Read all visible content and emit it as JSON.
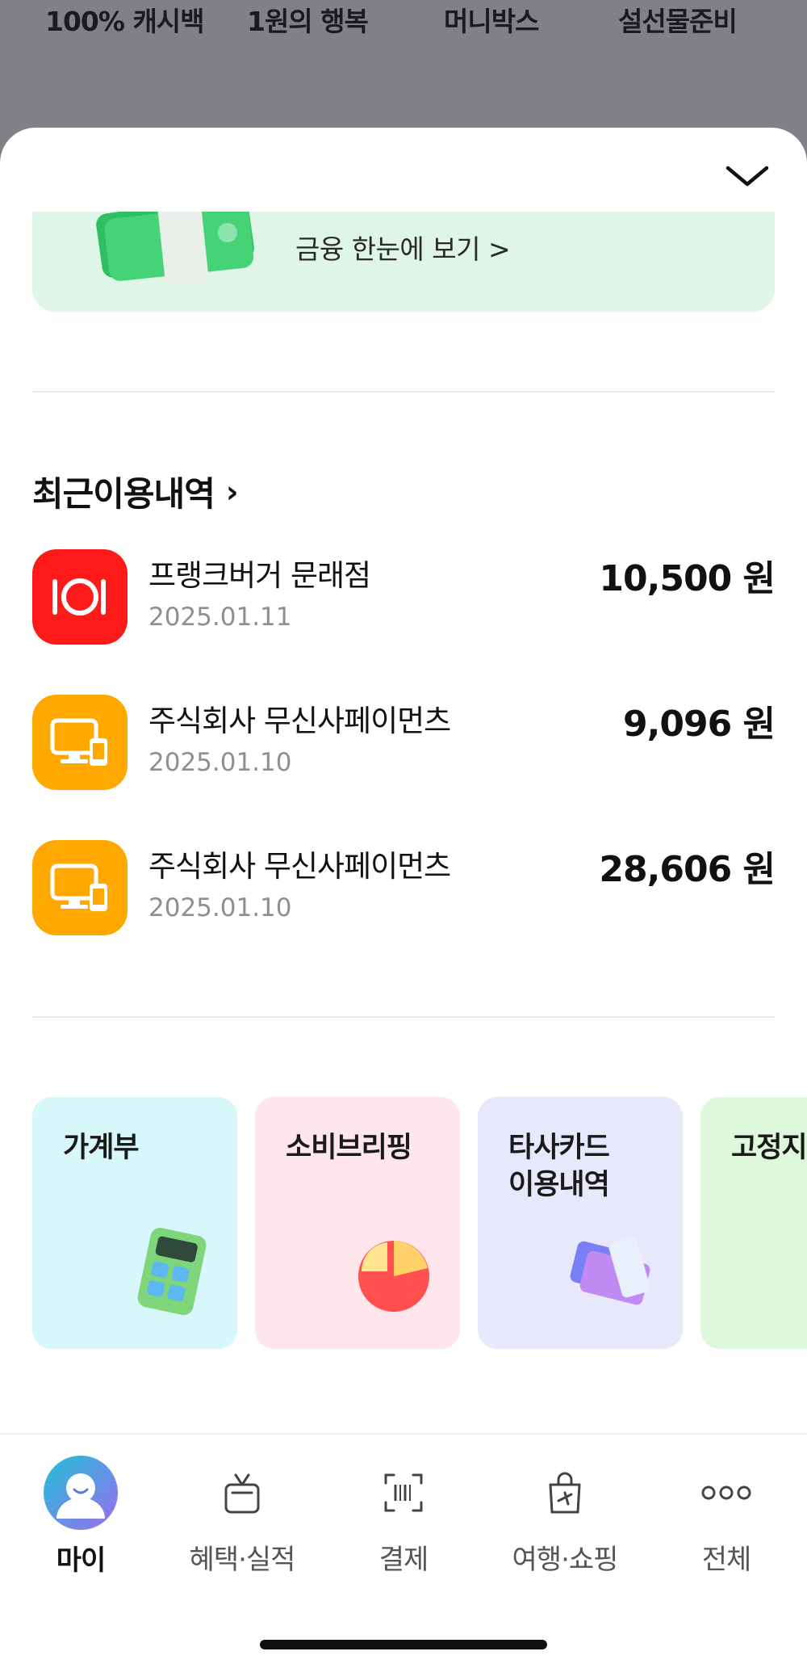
{
  "background_menu": [
    "100% 캐시백",
    "1원의 행복",
    "머니박스",
    "설선물준비"
  ],
  "promo": {
    "link_text": "금융 한눈에 보기 >"
  },
  "recent": {
    "title": "최근이용내역",
    "arrow": "›",
    "items": [
      {
        "name": "프랭크버거 문래점",
        "date": "2025.01.11",
        "amount": "10,500 원",
        "icon": "restaurant-icon",
        "color": "#ff1a1a"
      },
      {
        "name": "주식회사 무신사페이먼츠",
        "date": "2025.01.10",
        "amount": "9,096 원",
        "icon": "online-payment-icon",
        "color": "#ffa800"
      },
      {
        "name": "주식회사 무신사페이먼츠",
        "date": "2025.01.10",
        "amount": "28,606 원",
        "icon": "online-payment-icon",
        "color": "#ffa800"
      }
    ]
  },
  "cards": [
    {
      "label": "가계부",
      "bg": "#d8f7fb",
      "icon": "calculator-icon"
    },
    {
      "label": "소비브리핑",
      "bg": "#ffe6ec",
      "icon": "pie-chart-icon"
    },
    {
      "label": "타사카드\n이용내역",
      "bg": "#e8e8fd",
      "icon": "card-receipt-icon"
    },
    {
      "label": "고정지",
      "bg": "#def8dc",
      "icon": "money-icon"
    }
  ],
  "tabs": [
    {
      "label": "마이",
      "icon": "profile-avatar-icon",
      "active": true
    },
    {
      "label": "혜택·실적",
      "icon": "gift-icon",
      "active": false
    },
    {
      "label": "결제",
      "icon": "barcode-scan-icon",
      "active": false
    },
    {
      "label": "여행·쇼핑",
      "icon": "shopping-bag-plane-icon",
      "active": false
    },
    {
      "label": "전체",
      "icon": "more-dots-icon",
      "active": false
    }
  ],
  "colors": {
    "accent": "#ff1a1a",
    "orange": "#ffa800",
    "promo_bg": "#def5e8"
  }
}
